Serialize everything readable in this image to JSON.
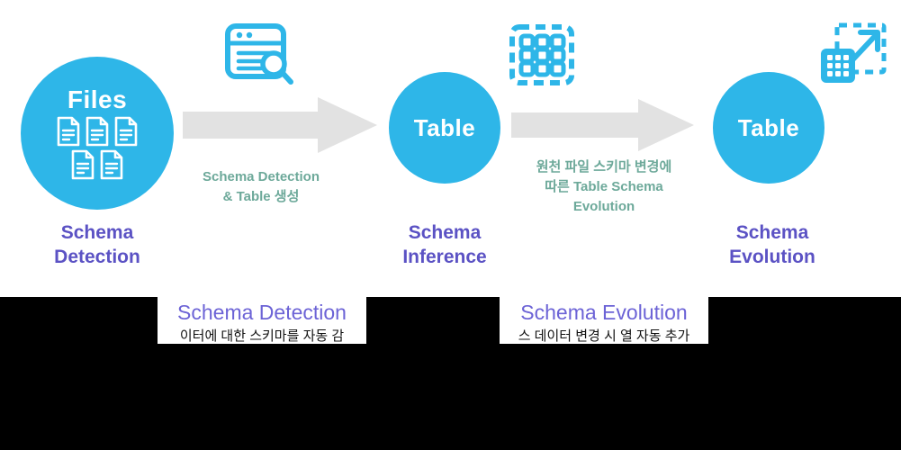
{
  "theme": {
    "circle_color": "#2eb6e8",
    "arrow_color": "#e2e2e2",
    "title_color": "#5b52c4",
    "caption_color": "#6da99a",
    "box_heading_color": "#6c63d6",
    "panel_background": "#ffffff",
    "page_background": "#000000"
  },
  "diagram": {
    "nodes": [
      {
        "id": "files",
        "circle_label": "Files",
        "title": "Schema\nDetection",
        "title_line1": "Schema",
        "title_line2": "Detection",
        "icon": "files-icon"
      },
      {
        "id": "table-1",
        "circle_label": "Table",
        "title": "Schema\nInference",
        "title_line1": "Schema",
        "title_line2": "Inference",
        "icon": "table-icon"
      },
      {
        "id": "table-2",
        "circle_label": "Table",
        "title": "Schema\nEvolution",
        "title_line1": "Schema",
        "title_line2": "Evolution",
        "icon": "table-icon"
      }
    ],
    "arrows": [
      {
        "id": "arrow-1",
        "caption_line1": "Schema Detection",
        "caption_line2": "& Table 생성"
      },
      {
        "id": "arrow-2",
        "caption_line1": "원천 파일 스키마 변경에",
        "caption_line2": "따른 Table Schema",
        "caption_line3": "Evolution"
      }
    ],
    "top_icons": [
      {
        "id": "icon-schema-detect",
        "name": "document-search-icon"
      },
      {
        "id": "icon-schema-grid",
        "name": "dashed-grid-icon"
      },
      {
        "id": "icon-schema-expand",
        "name": "grid-expand-icon"
      }
    ]
  },
  "bottom_captions": [
    {
      "id": "caption-box-1",
      "heading": "Schema Detection",
      "subtext": "이터에 대한 스키마를 자동 감"
    },
    {
      "id": "caption-box-2",
      "heading": "Schema Evolution",
      "subtext": "스 데이터 변경 시 열 자동 추가"
    }
  ]
}
